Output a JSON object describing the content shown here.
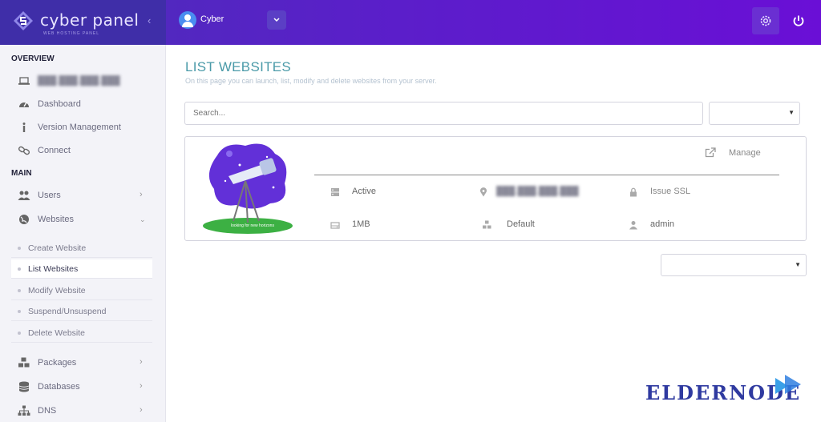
{
  "header": {
    "brand_name": "cyber panel",
    "brand_tagline": "WEB HOSTING PANEL",
    "user_name": "Cyber",
    "colors": {
      "gradient_start": "#4b2fb8",
      "gradient_end": "#6a0fd6",
      "brand_bg": "#3f2ea8"
    },
    "icons": {
      "logo": "cyberpanel-logo-icon",
      "avatar": "user-avatar-icon",
      "dropdown": "chevron-down-icon",
      "settings": "gear-icon",
      "power": "power-icon"
    }
  },
  "sidebar": {
    "overview_title": "OVERVIEW",
    "main_title": "MAIN",
    "overview_items": [
      {
        "label": "███.███.███.███",
        "icon": "laptop-icon"
      },
      {
        "label": "Dashboard",
        "icon": "dashboard-icon"
      },
      {
        "label": "Version Management",
        "icon": "info-icon"
      },
      {
        "label": "Connect",
        "icon": "link-icon"
      }
    ],
    "main_items": [
      {
        "label": "Users",
        "icon": "users-icon",
        "expanded": false
      },
      {
        "label": "Websites",
        "icon": "globe-icon",
        "expanded": true
      }
    ],
    "website_subitems": [
      {
        "label": "Create Website",
        "active": false
      },
      {
        "label": "List Websites",
        "active": true
      },
      {
        "label": "Modify Website",
        "active": false
      },
      {
        "label": "Suspend/Unsuspend",
        "active": false
      },
      {
        "label": "Delete Website",
        "active": false
      }
    ],
    "more_items": [
      {
        "label": "Packages",
        "icon": "cubes-icon"
      },
      {
        "label": "Databases",
        "icon": "database-icon"
      },
      {
        "label": "DNS",
        "icon": "sitemap-icon"
      }
    ]
  },
  "main": {
    "title": "LIST WEBSITES",
    "subtitle": "On this page you can launch, list, modify and delete websites from your server.",
    "search_placeholder": "Search...",
    "website_card": {
      "manage_label": "Manage",
      "status": "Active",
      "ip_address": "███.███.███.███",
      "ssl_label": "Issue SSL",
      "disk_usage": "1MB",
      "package": "Default",
      "owner": "admin",
      "preview_caption": "looking for new horizons",
      "icons": {
        "manage": "external-link-icon",
        "status": "server-icon",
        "ip": "map-marker-icon",
        "ssl": "lock-icon",
        "disk": "hdd-icon",
        "package": "cubes-icon",
        "owner": "user-icon"
      }
    }
  },
  "watermark": {
    "text": "ELDERNODE"
  }
}
